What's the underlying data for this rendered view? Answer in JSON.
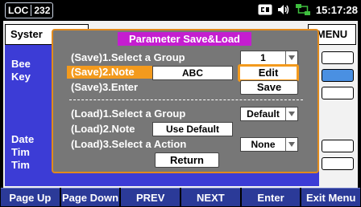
{
  "statusbar": {
    "loc_label": "LOC",
    "address": "232",
    "clock": "15:17:28"
  },
  "background": {
    "tab_label": "Syster",
    "menu_label": "MENU",
    "labels": [
      "Bee",
      "Key",
      "Date",
      "Tim",
      "Tim"
    ]
  },
  "dialog": {
    "title": "Parameter Save&Load",
    "save_group_label": "(Save)1.Select a Group",
    "save_group_value": "1",
    "save_note_label": "(Save)2.Note",
    "save_note_value": "ABC",
    "edit_label": "Edit",
    "save_enter_label": "(Save)3.Enter",
    "save_label": "Save",
    "load_group_label": "(Load)1.Select a Group",
    "load_group_value": "Default",
    "load_note_label": "(Load)2.Note",
    "load_note_value": "Use Default",
    "load_action_label": "(Load)3.Select a Action",
    "load_action_value": "None",
    "return_label": "Return"
  },
  "softkeys": [
    "Page Up",
    "Page Down",
    "PREV",
    "NEXT",
    "Enter",
    "Exit Menu"
  ],
  "colors": {
    "accent_orange": "#f39a1d",
    "title_magenta": "#c41ed0",
    "softkey_blue": "#2b3a98"
  }
}
